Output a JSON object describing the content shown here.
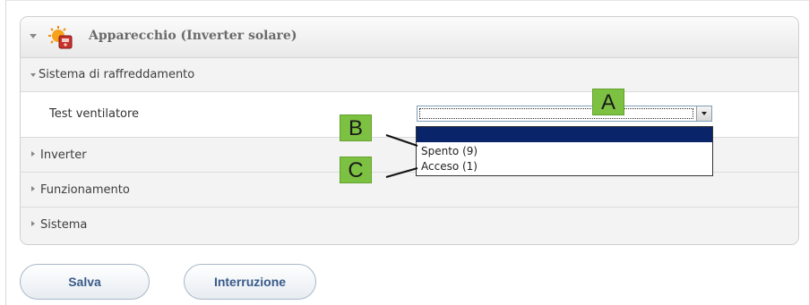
{
  "device_panel": {
    "title": "Apparecchio  (Inverter solare)",
    "icon": "solar-inverter-icon"
  },
  "sections": {
    "cooling": {
      "label": "Sistema di raffreddamento",
      "expanded": true
    },
    "inverter": {
      "label": "Inverter",
      "expanded": false
    },
    "operation": {
      "label": "Funzionamento",
      "expanded": false
    },
    "system": {
      "label": "Sistema",
      "expanded": false
    }
  },
  "fan_test": {
    "label": "Test ventilatore",
    "selected_value": "",
    "options": [
      "",
      "Spento (9)",
      "Acceso (1)"
    ]
  },
  "callouts": {
    "a": "A",
    "b": "B",
    "c": "C"
  },
  "buttons": {
    "save": "Salva",
    "cancel": "Interruzione"
  },
  "colors": {
    "callout": "#7dc142",
    "selected_option": "#0a246a",
    "button_text": "#3a5a8a"
  }
}
